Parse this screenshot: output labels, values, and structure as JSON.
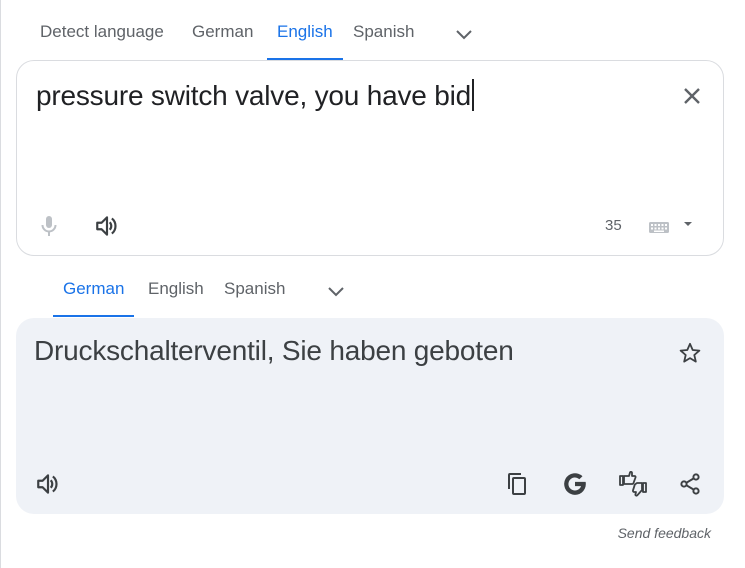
{
  "source_tabs": [
    "Detect language",
    "German",
    "English",
    "Spanish"
  ],
  "source_active_index": 2,
  "target_tabs": [
    "German",
    "English",
    "Spanish"
  ],
  "target_active_index": 0,
  "source": {
    "text": "pressure switch valve, you have bid",
    "char_count": "35"
  },
  "target": {
    "text": "Druckschalterventil, Sie haben geboten"
  },
  "footer": {
    "send_feedback": "Send feedback"
  },
  "colors": {
    "accent": "#1a73e8",
    "icon": "#5f6368",
    "disabled_icon": "#bdc1c6",
    "target_bg": "#eff2f7"
  },
  "icons": {
    "more_languages": "chevron-down-icon",
    "clear": "close-icon",
    "mic": "microphone-icon",
    "listen": "speaker-icon",
    "keyboard": "keyboard-icon",
    "input_tools_menu": "caret-down-icon",
    "save": "star-icon",
    "copy": "copy-icon",
    "google": "google-g-icon",
    "rate": "thumbs-up-down-icon",
    "share": "share-icon"
  }
}
